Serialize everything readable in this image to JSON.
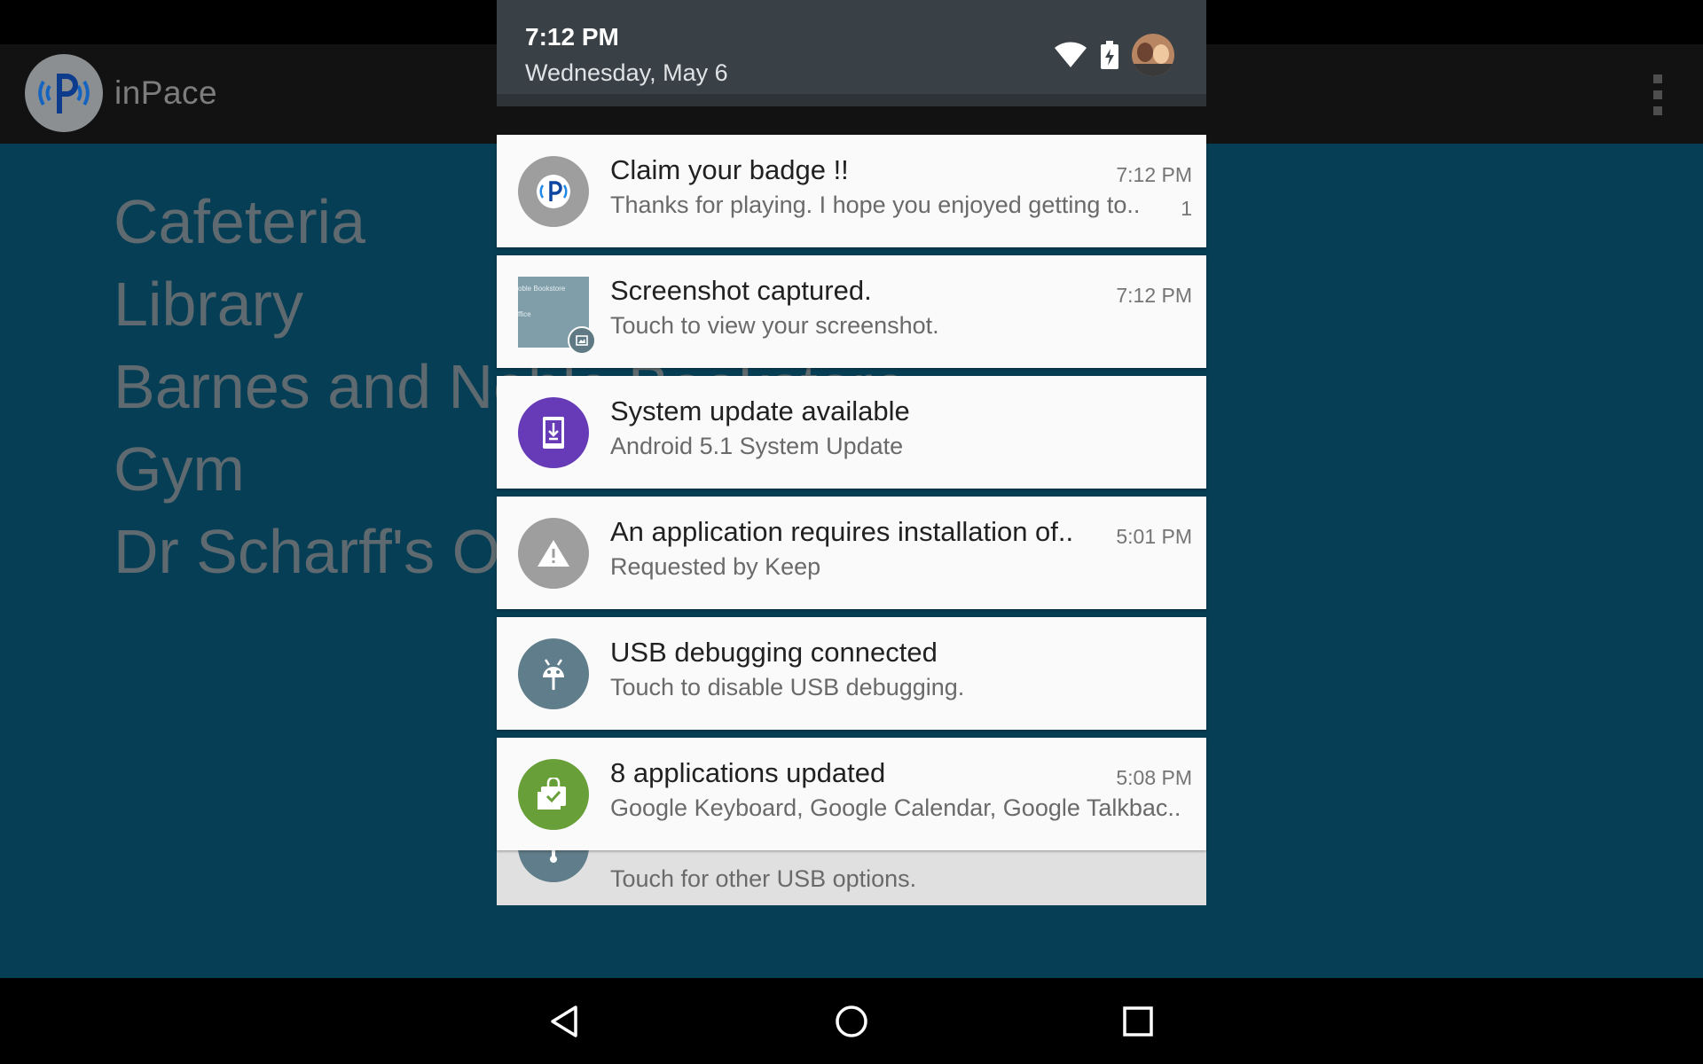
{
  "app": {
    "title": "inPace",
    "places": [
      "Cafeteria",
      "Library",
      "Barnes and Noble Bookstore",
      "Gym",
      "Dr Scharff's Office"
    ]
  },
  "shade": {
    "time": "7:12 PM",
    "date": "Wednesday, May 6",
    "icons": [
      "wifi-icon",
      "battery-charging-icon",
      "account-avatar"
    ]
  },
  "notifications": [
    {
      "title": "Claim your badge !!",
      "text": "Thanks for playing. I hope you enjoyed getting to..",
      "time": "7:12 PM",
      "count": "1",
      "icon": "inpace-app-icon",
      "icon_color": "#9e9e9e"
    },
    {
      "title": "Screenshot captured.",
      "text": "Touch to view your screenshot.",
      "time": "7:12 PM",
      "icon": "screenshot-thumbnail",
      "icon_color": "#5f7a84"
    },
    {
      "title": "System update available",
      "text": "Android 5.1 System Update",
      "icon": "system-update-icon",
      "icon_color": "#673ab7"
    },
    {
      "title": "An application requires installation of..",
      "text": "Requested by Keep",
      "time": "5:01 PM",
      "icon": "warning-icon",
      "icon_color": "#9e9e9e"
    },
    {
      "title": "USB debugging connected",
      "text": "Touch to disable USB debugging.",
      "icon": "android-debug-icon",
      "icon_color": "#607d8b"
    },
    {
      "title": "8 applications updated",
      "text": "Google Keyboard, Google Calendar, Google Talkbac..",
      "time": "5:08 PM",
      "icon": "play-store-update-icon",
      "icon_color": "#689f38"
    }
  ],
  "partial_notification": {
    "text": "Touch for other USB options."
  },
  "thumbnail_text": [
    "oble Bookstore",
    "ffice"
  ],
  "nav": [
    "back-icon",
    "home-icon",
    "recents-icon"
  ]
}
